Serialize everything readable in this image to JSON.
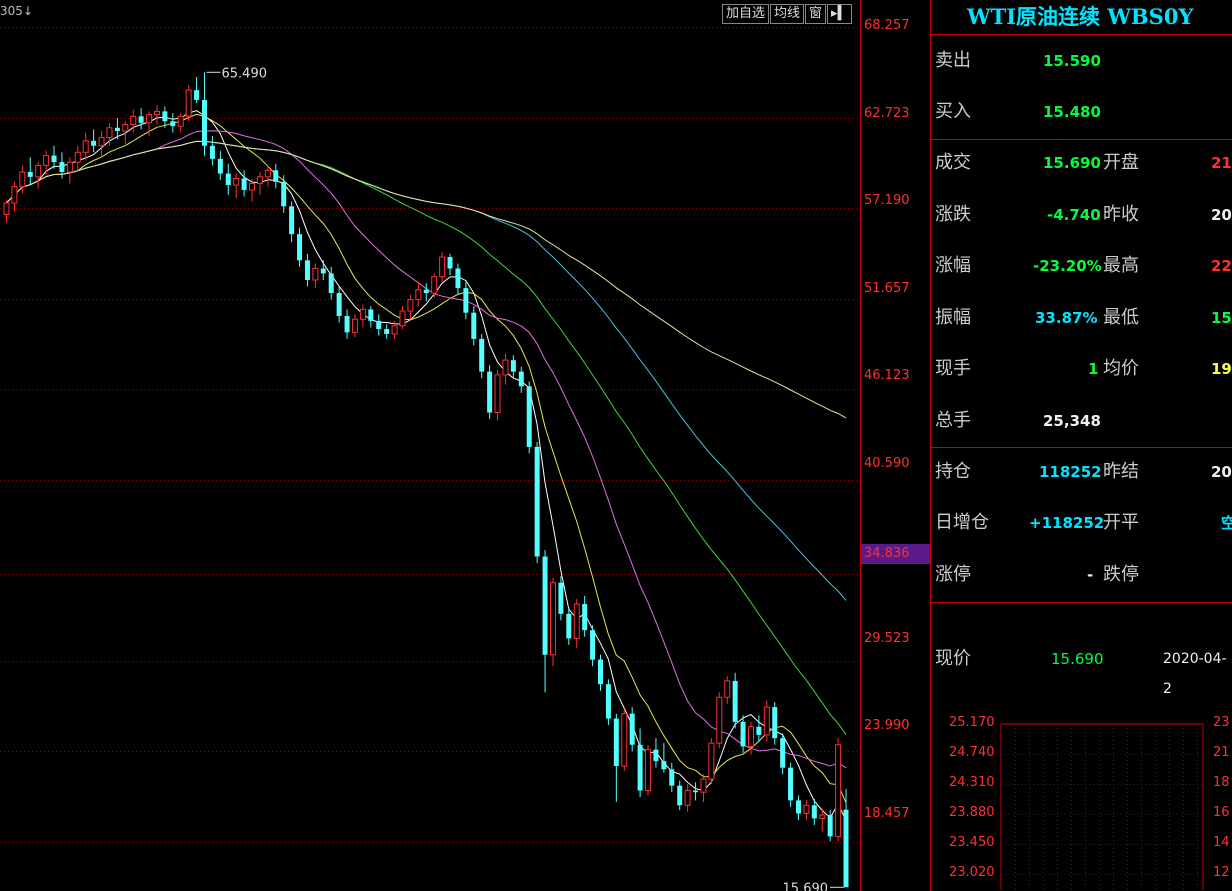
{
  "toolbar": {
    "contract_code": "305↓",
    "add_watch_label": "加自选",
    "ma_label": "均线",
    "window_label": "窗",
    "expand_icon": "push-right-icon"
  },
  "price_axis": {
    "ticks": [
      "68.257",
      "62.723",
      "57.190",
      "51.657",
      "46.123",
      "40.590",
      "34.836",
      "29.523",
      "23.990",
      "18.457"
    ],
    "current_tag": "34.836"
  },
  "quote_panel": {
    "title": "WTI原油连续 WBS0Y",
    "sell_label": "卖出",
    "sell_value": "15.590",
    "buy_label": "买入",
    "buy_value": "15.480",
    "volume_label": "成交",
    "volume_value": "15.690",
    "open_label": "开盘",
    "open_value": "21.",
    "change_label": "涨跌",
    "change_value": "-4.740",
    "prev_close_label": "昨收",
    "prev_close_value": "20.",
    "change_pct_label": "涨幅",
    "change_pct_value": "-23.20%",
    "high_label": "最高",
    "high_value": "22.",
    "amplitude_label": "振幅",
    "amplitude_value": "33.87%",
    "low_label": "最低",
    "low_value": "15.",
    "last_qty_label": "现手",
    "last_qty_value": "1",
    "avg_label": "均价",
    "avg_value": "19.",
    "total_label": "总手",
    "total_value": "25,348",
    "oi_label": "持仓",
    "oi_value": "118252",
    "prev_settle_label": "昨结",
    "prev_settle_value": "20.",
    "oi_change_label": "日增仓",
    "oi_change_value": "+118252",
    "open_close_label": "开平",
    "open_close_value": "空",
    "limit_up_label": "涨停",
    "limit_up_value": "-",
    "limit_down_label": "跌停",
    "limit_down_value": "",
    "now_label": "现价",
    "now_value": "15.690",
    "now_date": "2020-04-2"
  },
  "mini_chart": {
    "left_ticks": [
      "25.170",
      "24.740",
      "24.310",
      "23.880",
      "23.450",
      "23.020"
    ],
    "right_ticks": [
      "23",
      "21",
      "18",
      "16",
      "14",
      "12"
    ]
  },
  "chart_data": {
    "type": "candlestick",
    "y_axis_ticks": [
      68.257,
      62.723,
      57.19,
      51.657,
      46.123,
      40.59,
      34.836,
      29.523,
      23.99,
      18.457
    ],
    "ylim": [
      14.5,
      69.0
    ],
    "grid": true,
    "annotations": [
      {
        "text": "65.490",
        "value": 65.49,
        "kind": "high"
      },
      {
        "text": "15.690",
        "value": 15.69,
        "kind": "low"
      }
    ],
    "colors": {
      "up": "#ff3030",
      "down": "#54ffff",
      "ma5": "#ffffff",
      "ma10": "#e8e84a",
      "ma20": "#e070e0",
      "ma40": "#3ad83a",
      "ma60": "#3ac8e0",
      "ma120": "#e8e0a0"
    },
    "candles": [
      [
        56.8,
        57.7,
        56.3,
        57.5
      ],
      [
        57.5,
        58.8,
        57.0,
        58.5
      ],
      [
        58.5,
        59.8,
        58.1,
        59.4
      ],
      [
        59.4,
        60.3,
        58.6,
        59.1
      ],
      [
        59.1,
        60.0,
        58.4,
        59.8
      ],
      [
        59.8,
        60.7,
        59.2,
        60.4
      ],
      [
        60.4,
        61.0,
        59.6,
        60.0
      ],
      [
        60.0,
        60.6,
        59.0,
        59.4
      ],
      [
        59.4,
        60.3,
        58.7,
        60.0
      ],
      [
        60.0,
        61.0,
        59.5,
        60.6
      ],
      [
        60.6,
        61.8,
        60.1,
        61.3
      ],
      [
        61.3,
        62.0,
        60.6,
        61.0
      ],
      [
        61.0,
        61.9,
        60.3,
        61.5
      ],
      [
        61.5,
        62.4,
        61.0,
        62.1
      ],
      [
        62.1,
        62.7,
        61.4,
        61.9
      ],
      [
        61.9,
        62.5,
        61.1,
        62.3
      ],
      [
        62.3,
        63.2,
        61.8,
        62.8
      ],
      [
        62.8,
        63.3,
        62.0,
        62.4
      ],
      [
        62.4,
        63.1,
        61.6,
        62.9
      ],
      [
        62.9,
        63.5,
        62.3,
        63.1
      ],
      [
        63.1,
        63.4,
        62.1,
        62.5
      ],
      [
        62.5,
        63.0,
        61.8,
        62.2
      ],
      [
        62.2,
        63.0,
        61.8,
        62.8
      ],
      [
        62.8,
        64.7,
        62.5,
        64.4
      ],
      [
        64.4,
        65.2,
        63.6,
        63.8
      ],
      [
        63.8,
        65.49,
        60.4,
        61.0
      ],
      [
        61.0,
        61.6,
        59.8,
        60.2
      ],
      [
        60.2,
        60.7,
        58.9,
        59.3
      ],
      [
        59.3,
        59.9,
        58.0,
        58.6
      ],
      [
        58.6,
        59.3,
        57.8,
        59.0
      ],
      [
        59.0,
        59.5,
        57.9,
        58.3
      ],
      [
        58.3,
        59.0,
        57.6,
        58.7
      ],
      [
        58.7,
        59.4,
        58.0,
        59.1
      ],
      [
        59.1,
        59.8,
        58.5,
        59.5
      ],
      [
        59.5,
        59.9,
        58.4,
        58.8
      ],
      [
        58.8,
        59.2,
        56.9,
        57.3
      ],
      [
        57.3,
        57.6,
        55.1,
        55.6
      ],
      [
        55.6,
        56.0,
        53.6,
        54.0
      ],
      [
        54.0,
        54.4,
        52.4,
        52.8
      ],
      [
        52.8,
        53.8,
        52.3,
        53.5
      ],
      [
        53.5,
        54.0,
        52.8,
        53.2
      ],
      [
        53.2,
        53.6,
        51.6,
        52.0
      ],
      [
        52.0,
        52.4,
        50.2,
        50.6
      ],
      [
        50.6,
        51.0,
        49.2,
        49.6
      ],
      [
        49.6,
        50.7,
        49.3,
        50.4
      ],
      [
        50.4,
        51.3,
        49.9,
        51.0
      ],
      [
        51.0,
        51.2,
        49.9,
        50.3
      ],
      [
        50.3,
        50.7,
        49.4,
        49.8
      ],
      [
        49.8,
        50.1,
        49.2,
        49.5
      ],
      [
        49.5,
        50.3,
        49.2,
        50.0
      ],
      [
        50.0,
        51.2,
        49.8,
        50.9
      ],
      [
        50.9,
        51.9,
        50.4,
        51.6
      ],
      [
        51.6,
        52.7,
        51.2,
        52.2
      ],
      [
        52.2,
        52.6,
        51.5,
        52.0
      ],
      [
        52.0,
        53.2,
        51.7,
        53.0
      ],
      [
        53.0,
        54.5,
        52.7,
        54.2
      ],
      [
        54.2,
        54.4,
        53.1,
        53.5
      ],
      [
        53.5,
        53.8,
        51.9,
        52.3
      ],
      [
        52.3,
        52.7,
        50.4,
        50.8
      ],
      [
        50.8,
        51.2,
        48.8,
        49.2
      ],
      [
        49.2,
        49.5,
        46.8,
        47.2
      ],
      [
        47.2,
        47.6,
        44.3,
        44.7
      ],
      [
        44.7,
        47.3,
        44.2,
        47.0
      ],
      [
        47.0,
        48.3,
        46.4,
        47.9
      ],
      [
        47.9,
        48.2,
        46.8,
        47.2
      ],
      [
        47.2,
        47.5,
        45.9,
        46.3
      ],
      [
        46.3,
        46.6,
        42.2,
        42.6
      ],
      [
        42.6,
        42.9,
        35.5,
        35.9
      ],
      [
        35.9,
        36.3,
        27.6,
        29.9
      ],
      [
        29.9,
        34.6,
        29.2,
        34.3
      ],
      [
        34.3,
        34.7,
        32.0,
        32.4
      ],
      [
        32.4,
        32.8,
        30.5,
        30.9
      ],
      [
        30.9,
        33.3,
        30.3,
        33.0
      ],
      [
        33.0,
        33.5,
        31.0,
        31.4
      ],
      [
        31.4,
        31.7,
        29.2,
        29.6
      ],
      [
        29.6,
        29.9,
        27.7,
        28.1
      ],
      [
        28.1,
        28.4,
        25.6,
        26.0
      ],
      [
        26.0,
        26.3,
        20.9,
        23.1
      ],
      [
        23.1,
        26.6,
        22.8,
        26.3
      ],
      [
        26.3,
        26.7,
        24.0,
        24.4
      ],
      [
        24.4,
        25.4,
        21.2,
        21.6
      ],
      [
        21.6,
        24.4,
        21.3,
        24.1
      ],
      [
        24.1,
        24.8,
        23.0,
        23.4
      ],
      [
        23.4,
        24.5,
        22.7,
        22.9
      ],
      [
        22.9,
        23.3,
        21.5,
        21.9
      ],
      [
        21.9,
        22.2,
        20.4,
        20.7
      ],
      [
        20.7,
        22.0,
        20.3,
        21.6
      ],
      [
        21.6,
        22.1,
        21.0,
        21.5
      ],
      [
        21.5,
        22.6,
        20.9,
        22.3
      ],
      [
        22.3,
        24.8,
        22.0,
        24.5
      ],
      [
        24.5,
        27.6,
        24.2,
        27.3
      ],
      [
        27.3,
        28.6,
        26.9,
        28.3
      ],
      [
        28.3,
        28.8,
        25.4,
        25.8
      ],
      [
        25.8,
        26.2,
        23.9,
        24.3
      ],
      [
        24.3,
        25.8,
        23.8,
        25.5
      ],
      [
        25.5,
        26.2,
        24.6,
        25.0
      ],
      [
        25.0,
        27.1,
        24.6,
        26.7
      ],
      [
        26.7,
        27.0,
        24.4,
        24.8
      ],
      [
        24.8,
        25.1,
        22.6,
        23.0
      ],
      [
        23.0,
        23.3,
        20.6,
        21.0
      ],
      [
        21.0,
        21.3,
        19.8,
        20.2
      ],
      [
        20.2,
        21.0,
        19.8,
        20.7
      ],
      [
        20.7,
        21.1,
        19.5,
        19.9
      ],
      [
        19.9,
        20.5,
        19.1,
        20.1
      ],
      [
        20.1,
        20.4,
        18.5,
        18.8
      ],
      [
        18.8,
        24.8,
        18.5,
        24.4
      ],
      [
        20.43,
        21.7,
        15.69,
        15.69
      ]
    ]
  }
}
